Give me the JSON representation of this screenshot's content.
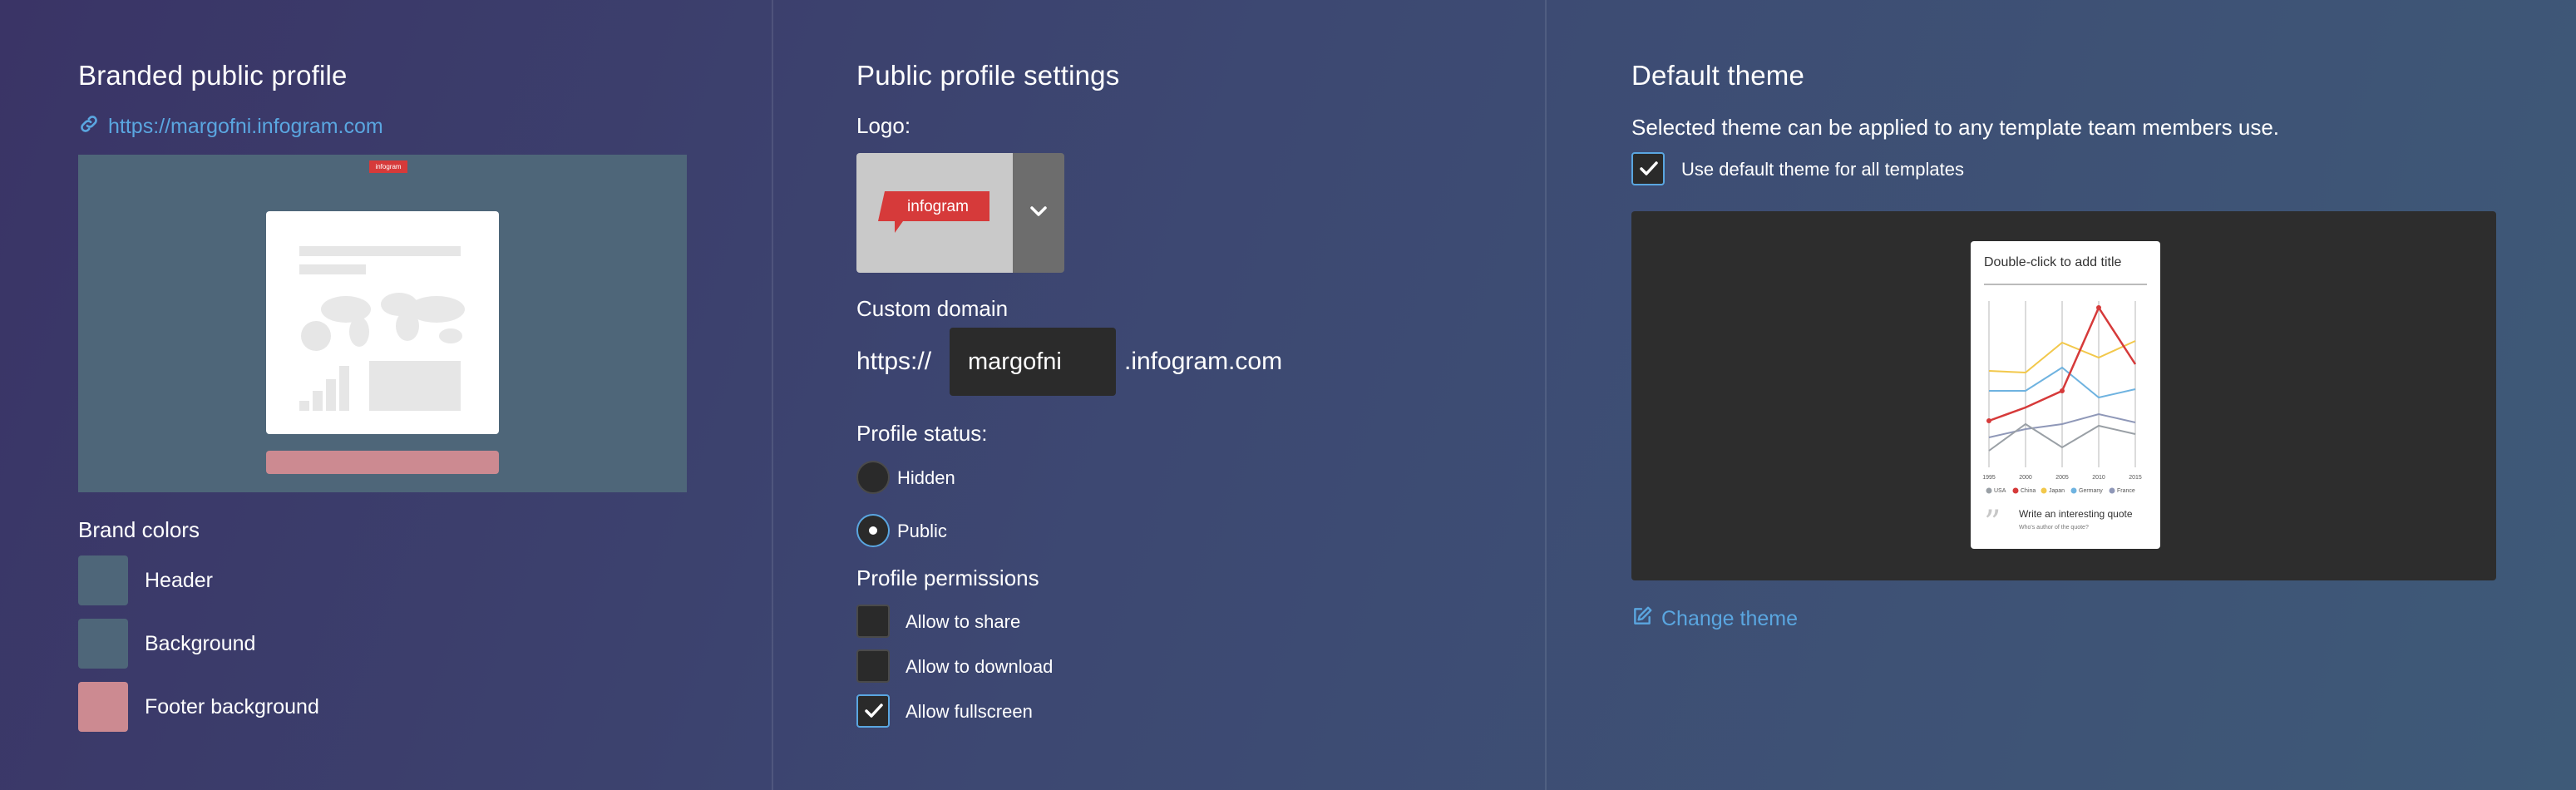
{
  "branded": {
    "title": "Branded public profile",
    "url": "https://margofni.infogram.com",
    "preview_logo_text": "infogram",
    "brand_colors_title": "Brand colors",
    "colors": [
      {
        "label": "Header",
        "color": "#4e6679"
      },
      {
        "label": "Background",
        "color": "#4e6679"
      },
      {
        "label": "Footer background",
        "color": "#cc8a91"
      }
    ]
  },
  "settings": {
    "title": "Public profile settings",
    "logo_label": "Logo:",
    "logo_text": "infogram",
    "custom_domain_label": "Custom domain",
    "domain_prefix": "https://",
    "domain_value": "margofni",
    "domain_suffix": ".infogram.com",
    "status_label": "Profile status:",
    "status_options": [
      {
        "label": "Hidden",
        "selected": false
      },
      {
        "label": "Public",
        "selected": true
      }
    ],
    "permissions_label": "Profile permissions",
    "permissions": [
      {
        "label": "Allow to share",
        "checked": false
      },
      {
        "label": "Allow to download",
        "checked": false
      },
      {
        "label": "Allow fullscreen",
        "checked": true
      }
    ]
  },
  "theme": {
    "title": "Default theme",
    "description": "Selected theme can be applied to any template team members use.",
    "use_default_label": "Use default theme for all templates",
    "use_default_checked": true,
    "card_title": "Double-click to add title",
    "x_ticks": [
      "1995",
      "2000",
      "2005",
      "2010",
      "2015"
    ],
    "legend": [
      {
        "name": "USA",
        "color": "#9aa0a6"
      },
      {
        "name": "China",
        "color": "#d63a3a"
      },
      {
        "name": "Japan",
        "color": "#f2c84b"
      },
      {
        "name": "Germany",
        "color": "#6fb3e0"
      },
      {
        "name": "France",
        "color": "#8f98b8"
      }
    ],
    "quote_text": "Write an interesting quote",
    "quote_author": "Who's author of the quote?",
    "change_theme_label": "Change theme"
  },
  "colors": {
    "accent": "#5aa6e0",
    "logo_red": "#d63a3a"
  }
}
